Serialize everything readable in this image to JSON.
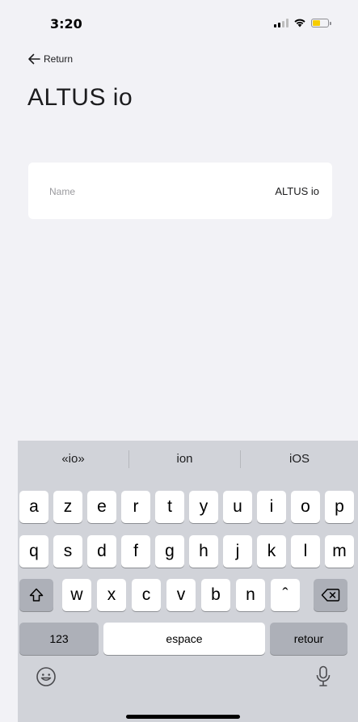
{
  "status_bar": {
    "time": "3:20",
    "battery_level": 0.45,
    "battery_color": "#f7cd00"
  },
  "header": {
    "back_label": "Return",
    "title": "ALTUS io"
  },
  "card": {
    "name_label": "Name",
    "name_value": "ALTUS io"
  },
  "keyboard": {
    "suggestions": [
      "«io»",
      "ion",
      "iOS"
    ],
    "row1": [
      "a",
      "z",
      "e",
      "r",
      "t",
      "y",
      "u",
      "i",
      "o",
      "p"
    ],
    "row2": [
      "q",
      "s",
      "d",
      "f",
      "g",
      "h",
      "j",
      "k",
      "l",
      "m"
    ],
    "row3": [
      "w",
      "x",
      "c",
      "v",
      "b",
      "n",
      "ˆ"
    ],
    "numbers_key": "123",
    "space_key": "espace",
    "return_key": "retour",
    "emoji_icon": "emoji-icon",
    "mic_icon": "microphone-icon",
    "shift_icon": "shift-icon",
    "delete_icon": "delete-icon"
  }
}
